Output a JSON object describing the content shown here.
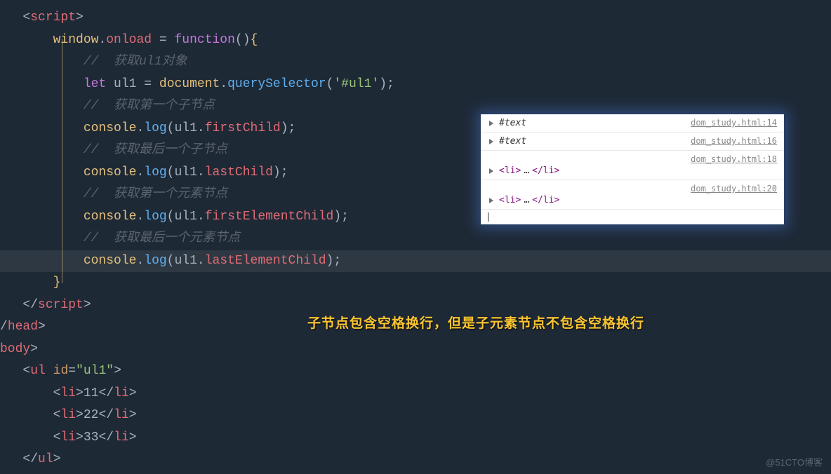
{
  "code": {
    "l1_tag": "script",
    "l2_obj": "window",
    "l2_prop": "onload",
    "l2_kw": "function",
    "l3_comment": "//  获取ul1对象",
    "l4_kw": "let",
    "l4_var": "ul1",
    "l4_obj": "document",
    "l4_fn": "querySelector",
    "l4_str": "'#ul1'",
    "l5_comment": "//  获取第一个子节点",
    "l6_obj": "console",
    "l6_fn": "log",
    "l6_arg1": "ul1",
    "l6_arg2": "firstChild",
    "l7_comment": "//  获取最后一个子节点",
    "l8_arg2": "lastChild",
    "l9_comment": "//  获取第一个元素节点",
    "l10_arg2": "firstElementChild",
    "l11_comment": "//  获取最后一个元素节点",
    "l12_arg2": "lastElementChild",
    "l13_tag": "script",
    "l14_tag": "head",
    "l15_tag": "body",
    "l16_tag": "ul",
    "l16_attr": "id",
    "l16_val": "\"ul1\"",
    "l17_tag": "li",
    "l17_txt": "11",
    "l18_txt": "22",
    "l19_txt": "33",
    "l20_tag": "ul"
  },
  "console": {
    "r1_content": "#text",
    "r1_src": "dom_study.html:14",
    "r2_content": "#text",
    "r2_src": "dom_study.html:16",
    "r3_src": "dom_study.html:18",
    "r3_tag_open": "<li>",
    "r3_dots": "…",
    "r3_tag_close": "</li>",
    "r4_src": "dom_study.html:20",
    "r4_tag_open": "<li>",
    "r4_dots": "…",
    "r4_tag_close": "</li>"
  },
  "annotation": "子节点包含空格换行，但是子元素节点不包含空格换行",
  "watermark": "@51CTO博客"
}
